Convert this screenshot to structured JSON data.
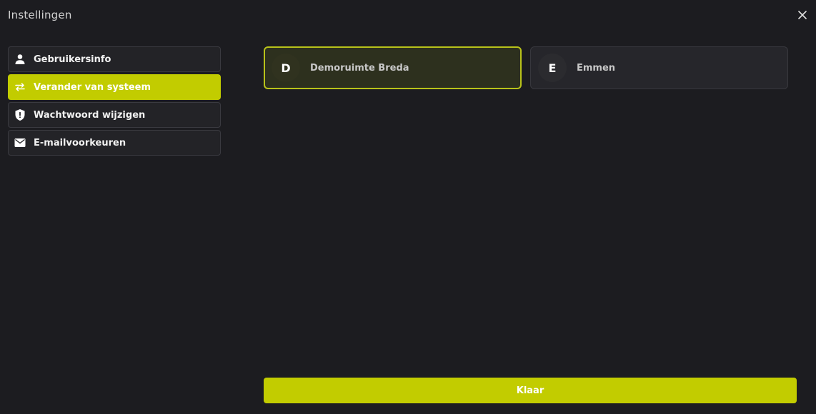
{
  "dialog": {
    "title": "Instellingen",
    "close_icon": "close-icon"
  },
  "sidebar": {
    "items": [
      {
        "label": "Gebruikersinfo",
        "icon": "person-icon",
        "active": false
      },
      {
        "label": "Verander van systeem",
        "icon": "swap-arrows-icon",
        "active": true
      },
      {
        "label": "Wachtwoord wijzigen",
        "icon": "shield-alert-icon",
        "active": false
      },
      {
        "label": "E-mailvoorkeuren",
        "icon": "envelope-icon",
        "active": false
      }
    ]
  },
  "systems": [
    {
      "initial": "D",
      "name": "Demoruimte Breda",
      "selected": true
    },
    {
      "initial": "E",
      "name": "Emmen",
      "selected": false
    }
  ],
  "footer": {
    "done_label": "Klaar"
  },
  "colors": {
    "background": "#1c1c20",
    "accent": "#c2cc00",
    "selected_border": "#b8c21a"
  }
}
